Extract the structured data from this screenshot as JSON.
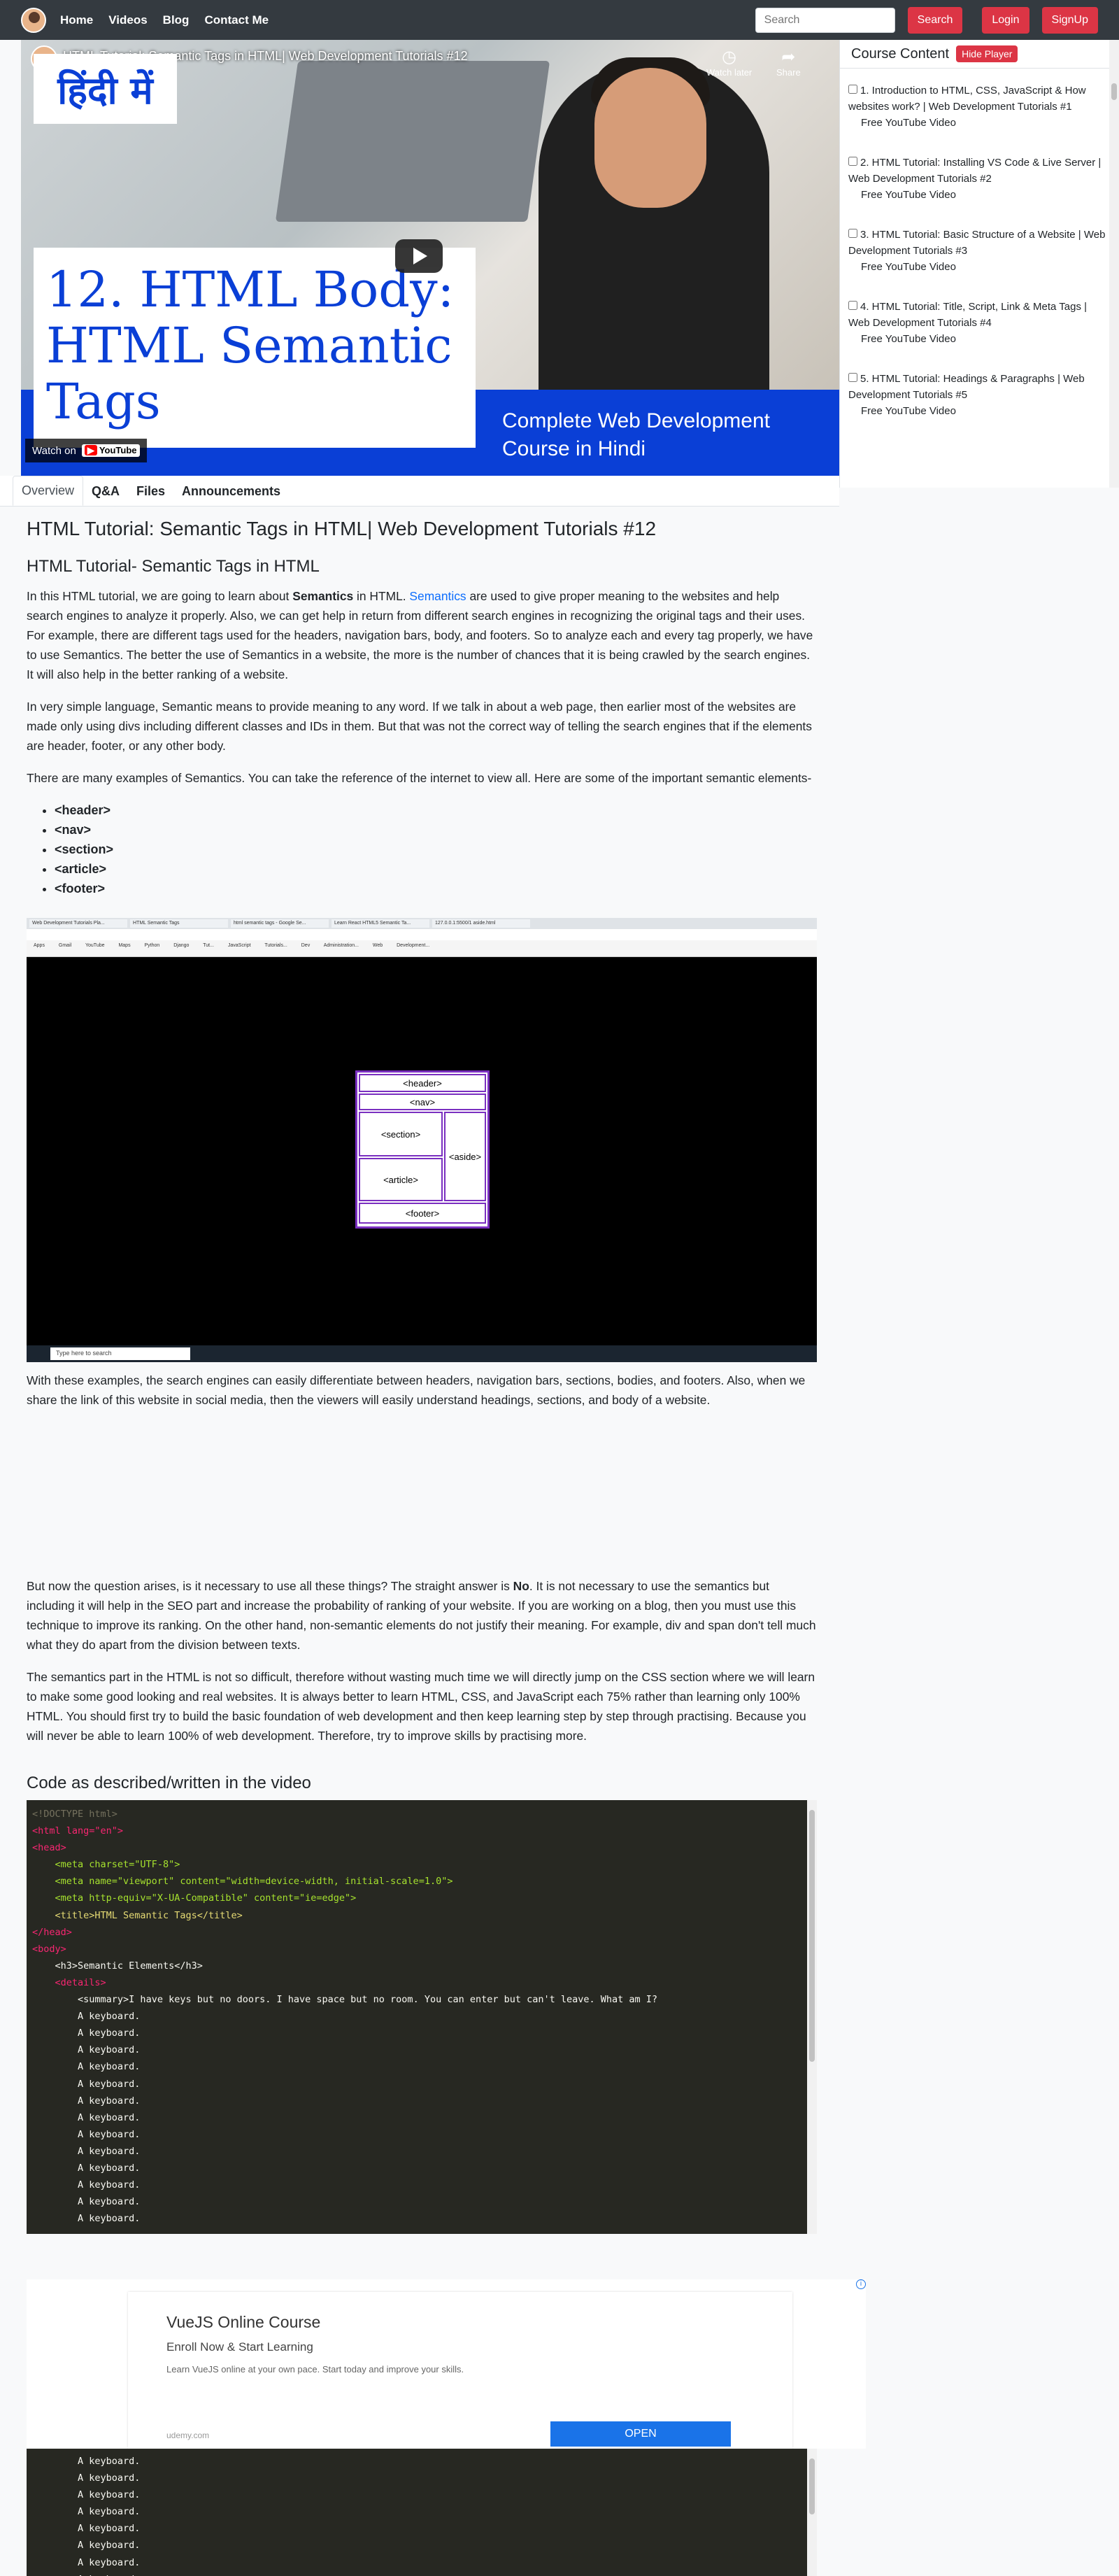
{
  "navbar": {
    "links": [
      "Home",
      "Videos",
      "Blog",
      "Contact Me"
    ],
    "search_placeholder": "Search",
    "search_button": "Search",
    "login": "Login",
    "signup": "SignUp"
  },
  "video": {
    "yt_title": "HTML Tutorial: Semantic Tags in HTML| Web Development Tutorials #12",
    "watch_later": "Watch later",
    "share": "Share",
    "thumb_hindi": "हिंदी में",
    "thumb_title_lines": [
      "12. HTML Body:",
      "HTML Semantic",
      "Tags"
    ],
    "thumb_course_lines": [
      "Complete Web Development",
      "Course in Hindi"
    ],
    "watch_on": "Watch on",
    "youtube": "YouTube"
  },
  "sidebar": {
    "title": "Course Content",
    "hide_player": "Hide Player",
    "items": [
      {
        "label": "1. Introduction to HTML, CSS, JavaScript & How websites work? | Web Development Tutorials #1",
        "sub": "Free YouTube Video"
      },
      {
        "label": "2. HTML Tutorial: Installing VS Code & Live Server | Web Development Tutorials #2",
        "sub": "Free YouTube Video"
      },
      {
        "label": "3. HTML Tutorial: Basic Structure of a Website | Web Development Tutorials #3",
        "sub": "Free YouTube Video"
      },
      {
        "label": "4. HTML Tutorial: Title, Script, Link & Meta Tags | Web Development Tutorials #4",
        "sub": "Free YouTube Video"
      },
      {
        "label": "5. HTML Tutorial: Headings & Paragraphs | Web Development Tutorials #5",
        "sub": "Free YouTube Video"
      }
    ]
  },
  "tabs": [
    "Overview",
    "Q&A",
    "Files",
    "Announcements"
  ],
  "article": {
    "title": "HTML Tutorial: Semantic Tags in HTML| Web Development Tutorials #12",
    "subtitle": "HTML Tutorial- Semantic Tags in HTML",
    "p1_a": "In this HTML tutorial, we are going to learn about ",
    "p1_b": "Semantics",
    "p1_c": " in HTML. ",
    "p1_link": "Semantics",
    "p1_d": " are used to give proper meaning to the websites and help search engines to analyze it properly. Also, we can get help in return from different search engines in recognizing the original tags and their uses. For example, there are different tags used for the headers, navigation bars, body, and footers. So to analyze each and every tag properly, we have to use Semantics. The better the use of Semantics in a website, the more is the number of chances that it is being crawled by the search engines. It will also help in the better ranking of a website.",
    "p2": "In very simple language, Semantic means to provide meaning to any word. If we talk in about a web page, then earlier most of the websites are made only using divs including different classes and IDs in them. But that was not the correct way of telling the search engines that if the elements are header, footer, or any other body.",
    "p3": "There are many examples of Semantics. You can take the reference of the internet to view all. Here are some of the important semantic elements-",
    "tags": [
      "<header>",
      "<nav>",
      "<section>",
      "<article>",
      "<footer>"
    ],
    "p4": "With these examples, the search engines can easily differentiate between headers, navigation bars, sections, bodies, and footers. Also, when we share the link of this website in social media, then the viewers will easily understand headings, sections, and body of a website.",
    "p5_a": "But now the question arises, is it necessary to use all these things? The straight answer is ",
    "p5_b": "No",
    "p5_c": ". It is not necessary to use the semantics but including it will help in the SEO part and increase the probability of ranking of your website. If you are working on a blog, then you must use this technique to improve its ranking. On the other hand, non-semantic elements do not justify their meaning. For example, div and span don't tell much what they do apart from the division between texts.",
    "p6": "The semantics part in the HTML is not so difficult, therefore without wasting much time we will directly jump on the CSS section where we will learn to make some good looking and real websites. It is always better to learn HTML, CSS, and JavaScript each 75% rather than learning only 100% HTML. You should first try to build the basic foundation of web development and then keep learning step by step through practising. Because you will never be able to learn 100% of web development. Therefore, try to improve skills by practising more.",
    "code_title": "Code as described/written in the video"
  },
  "screenshot": {
    "tabs": [
      "Web Development Tutorials Pla...",
      "HTML Semantic Tags",
      "html semantic tags - Google Se...",
      "Learn React HTML5 Semantic Ta...",
      "127.0.0.1:5500/1 aside.html"
    ],
    "bookmarks": "Apps Gmail YouTube Maps Python Django Tut... JavaScript Tutorials... Dev Administration... Web Development...",
    "taskbar_search": "Type here to search",
    "boxes": {
      "header": "<header>",
      "nav": "<nav>",
      "section": "<section>",
      "article": "<article>",
      "aside": "<aside>",
      "footer": "<footer>"
    }
  },
  "code": {
    "doctype": "<!DOCTYPE html>",
    "html_open": "<html lang=\"en\">",
    "head_open": "<head>",
    "meta1": "<meta charset=\"UTF-8\">",
    "meta2": "<meta name=\"viewport\" content=\"width=device-width, initial-scale=1.0\">",
    "meta3": "<meta http-equiv=\"X-UA-Compatible\" content=\"ie=edge\">",
    "title": "<title>HTML Semantic Tags</title>",
    "head_close": "</head>",
    "body_open": "<body>",
    "h3": "<h3>Semantic Elements</h3>",
    "details": "<details>",
    "summary": "<summary>I have keys but no doors. I have space but no room. You can enter but can't leave. What am I?",
    "keyboard": "A keyboard."
  },
  "ad": {
    "title": "VueJS Online Course",
    "subtitle": "Enroll Now & Start Learning",
    "desc": "Learn VueJS online at your own pace. Start today and improve your skills.",
    "domain": "udemy.com",
    "open": "OPEN"
  }
}
